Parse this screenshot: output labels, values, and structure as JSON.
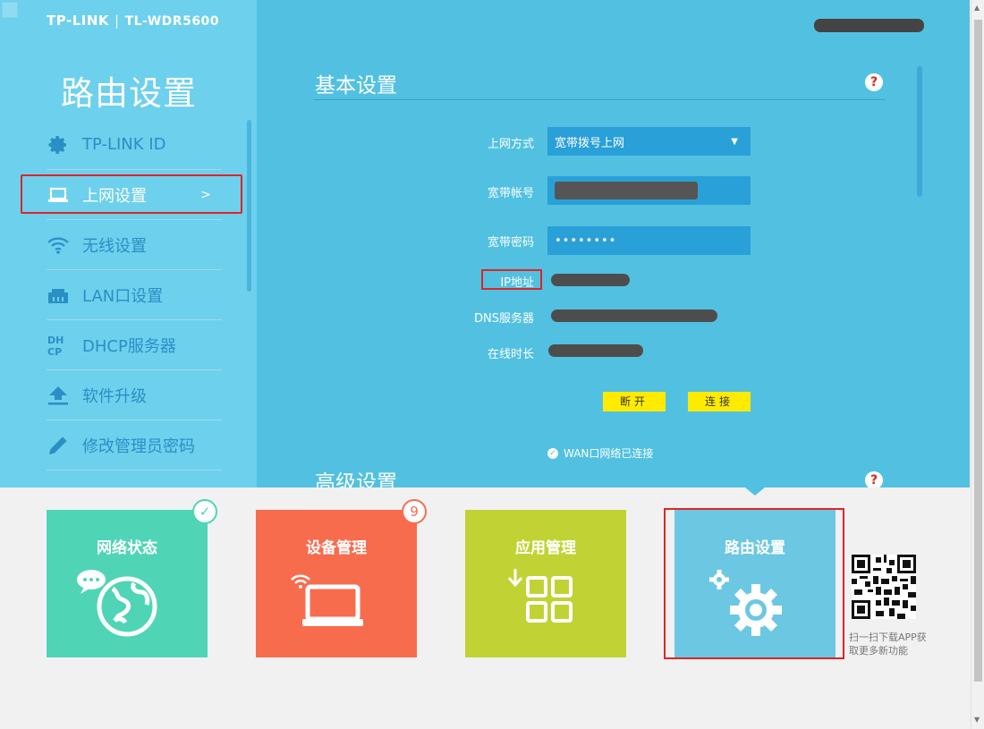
{
  "header": {
    "brand": "TP-LINK",
    "separator": "|",
    "model": "TL-WDR5600"
  },
  "sidebar": {
    "title": "路由设置",
    "items": [
      {
        "label": "TP-LINK ID",
        "icon": "gear-icon"
      },
      {
        "label": "上网设置",
        "icon": "laptop-icon",
        "active": true,
        "arrow": ">"
      },
      {
        "label": "无线设置",
        "icon": "wifi-icon"
      },
      {
        "label": "LAN口设置",
        "icon": "lan-port-icon"
      },
      {
        "label": "DHCP服务器",
        "icon": "dhcp-icon"
      },
      {
        "label": "软件升级",
        "icon": "upgrade-icon"
      },
      {
        "label": "修改管理员密码",
        "icon": "pencil-icon"
      }
    ]
  },
  "basic": {
    "title": "基本设置",
    "help": "?",
    "connection_type": {
      "label": "上网方式",
      "value": "宽带拨号上网"
    },
    "account": {
      "label": "宽带帐号"
    },
    "password": {
      "label": "宽带密码",
      "value": "••••••••"
    },
    "ip": {
      "label": "IP地址"
    },
    "dns": {
      "label": "DNS服务器"
    },
    "uptime": {
      "label": "在线时长"
    },
    "disconnect": "断开",
    "connect": "连接",
    "wan_status": "WAN口网络已连接"
  },
  "advanced": {
    "title": "高级设置",
    "help": "?"
  },
  "tiles": [
    {
      "label": "网络状态",
      "badge": "✓"
    },
    {
      "label": "设备管理",
      "badge": "9"
    },
    {
      "label": "应用管理"
    },
    {
      "label": "路由设置"
    }
  ],
  "qr": {
    "text": "扫一扫下载APP获取更多新功能"
  },
  "colors": {
    "main_bg": "#52c1e1",
    "sidebar_bg": "#6dd0ed",
    "highlight": "#e02424",
    "button": "#ffeb00"
  }
}
